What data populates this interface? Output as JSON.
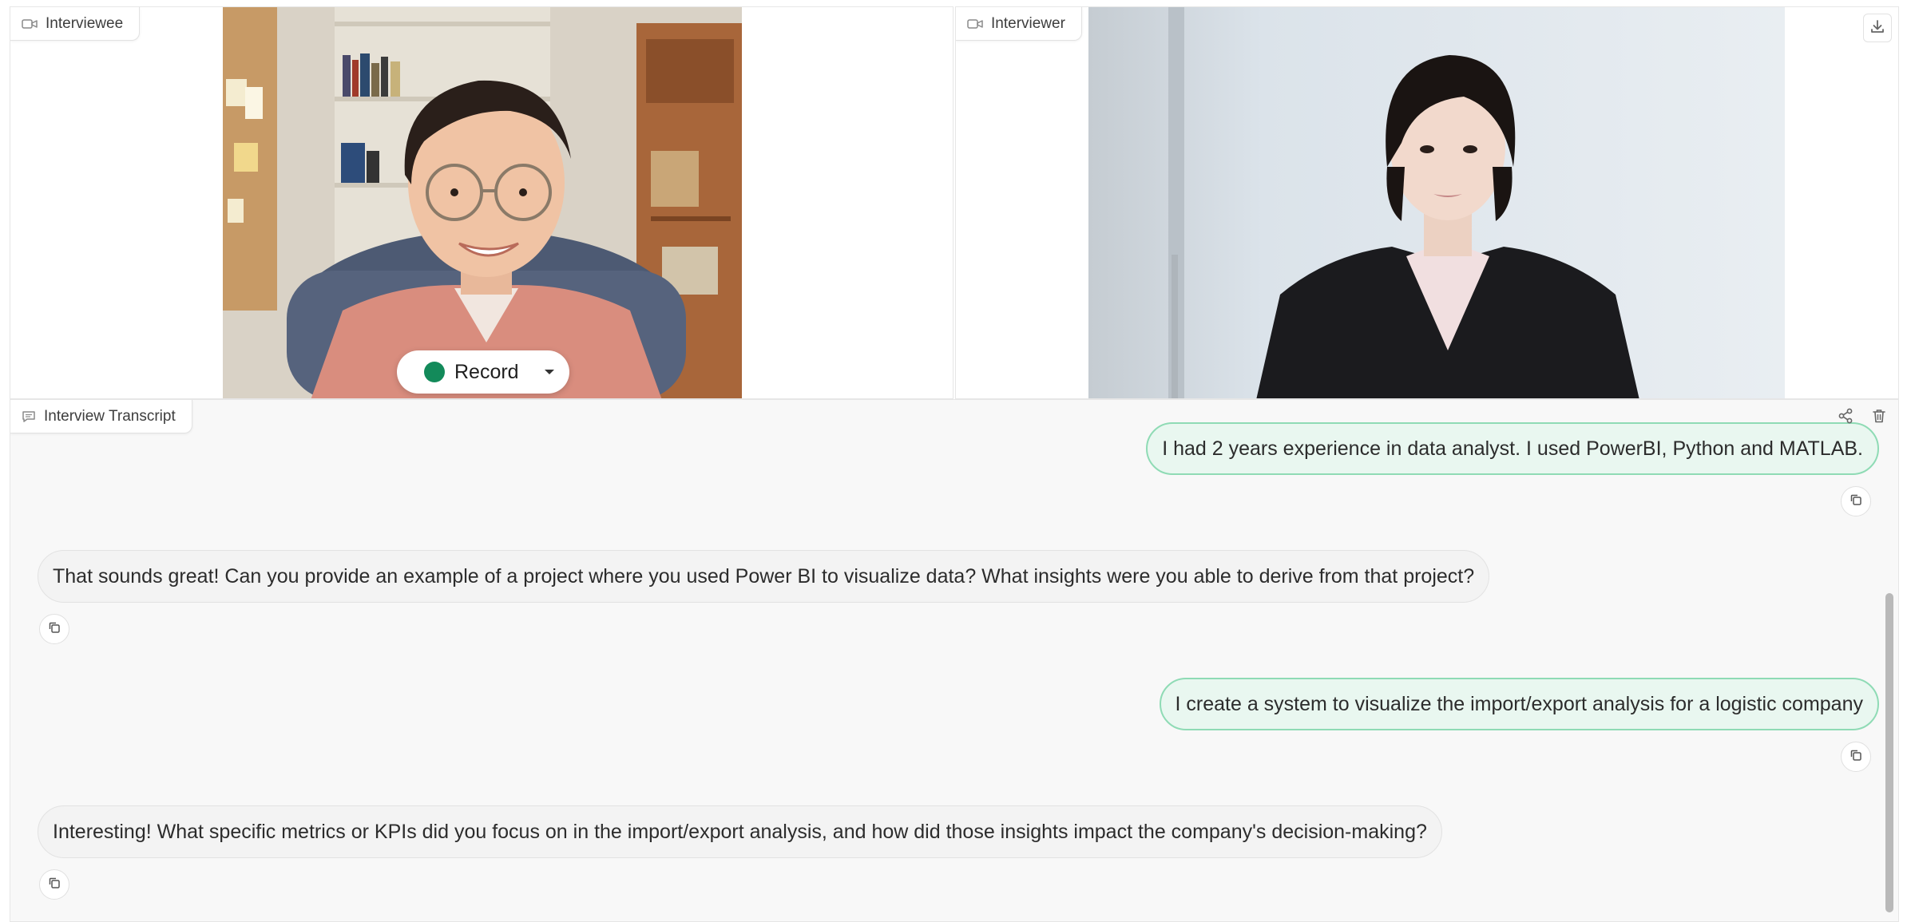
{
  "panels": {
    "interviewee": {
      "label": "Interviewee",
      "icon": "video-camera-icon"
    },
    "interviewer": {
      "label": "Interviewer",
      "icon": "video-camera-icon"
    },
    "transcript": {
      "label": "Interview Transcript",
      "icon": "chat-bubble-icon"
    }
  },
  "record": {
    "label": "Record",
    "dot_color": "#138a5a",
    "icon": "chevron-down-icon"
  },
  "toolbar": {
    "download_icon": "download-icon",
    "share_icon": "share-icon",
    "delete_icon": "trash-icon"
  },
  "messages": [
    {
      "role": "user",
      "text": "I had 2 years experience in data analyst. I used PowerBI, Python and MATLAB."
    },
    {
      "role": "assistant",
      "text": "That sounds great! Can you provide an example of a project where you used Power BI to visualize data? What insights were you able to derive from that project?"
    },
    {
      "role": "user",
      "text": "I create a system to visualize the import/export analysis for a logistic company"
    },
    {
      "role": "assistant",
      "text": "Interesting! What specific metrics or KPIs did you focus on in the import/export analysis, and how did those insights impact the company's decision-making?"
    }
  ],
  "colors": {
    "user_bubble_bg": "#e9f7f0",
    "user_bubble_border": "#8fdbb5",
    "assistant_bubble_bg": "#f3f3f3"
  }
}
